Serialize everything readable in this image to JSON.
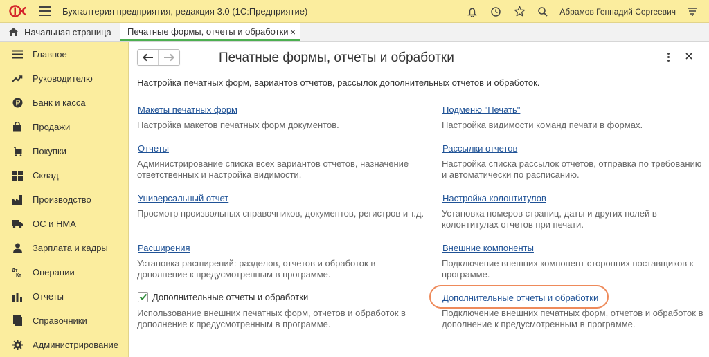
{
  "app": {
    "title": "Бухгалтерия предприятия, редакция 3.0  (1С:Предприятие)",
    "user": "Абрамов Геннадий Сергеевич"
  },
  "tabs": {
    "home": "Начальная страница",
    "active": "Печатные формы, отчеты и обработки",
    "close": "×"
  },
  "sidebar": {
    "items": [
      {
        "label": "Главное",
        "icon": "menu-lines-icon"
      },
      {
        "label": "Руководителю",
        "icon": "trend-icon"
      },
      {
        "label": "Банк и касса",
        "icon": "ruble-coin-icon"
      },
      {
        "label": "Продажи",
        "icon": "shopping-bag-icon"
      },
      {
        "label": "Покупки",
        "icon": "cart-icon"
      },
      {
        "label": "Склад",
        "icon": "warehouse-icon"
      },
      {
        "label": "Производство",
        "icon": "factory-icon"
      },
      {
        "label": "ОС и НМА",
        "icon": "truck-icon"
      },
      {
        "label": "Зарплата и кадры",
        "icon": "person-icon"
      },
      {
        "label": "Операции",
        "icon": "dt-kt-icon"
      },
      {
        "label": "Отчеты",
        "icon": "bar-chart-icon"
      },
      {
        "label": "Справочники",
        "icon": "book-icon"
      },
      {
        "label": "Администрирование",
        "icon": "gear-icon"
      }
    ]
  },
  "main": {
    "title": "Печатные формы, отчеты и обработки",
    "intro": "Настройка печатных форм, вариантов отчетов, рассылок дополнительных отчетов и обработок.",
    "left": [
      {
        "link": "Макеты печатных форм",
        "desc": "Настройка макетов печатных форм документов."
      },
      {
        "link": "Отчеты",
        "desc": "Администрирование списка всех вариантов отчетов, назначение ответственных и настройка видимости."
      },
      {
        "link": "Универсальный отчет",
        "desc": "Просмотр произвольных справочников, документов, регистров и т.д."
      },
      {
        "link": "Расширения",
        "desc": "Установка расширений: разделов, отчетов и обработок в дополнение к предусмотренным в программе."
      }
    ],
    "checkbox": {
      "label": "Дополнительные отчеты и обработки",
      "checked": true,
      "desc": "Использование внешних печатных форм, отчетов и обработок в дополнение к предусмотренным в программе."
    },
    "right": [
      {
        "link": "Подменю \"Печать\"",
        "desc": "Настройка видимости команд печати в формах."
      },
      {
        "link": "Рассылки отчетов",
        "desc": "Настройка списка рассылок отчетов, отправка по требованию и автоматически по расписанию."
      },
      {
        "link": "Настройка колонтитулов",
        "desc": "Установка номеров страниц, даты и других полей в колонтитулах отчетов при печати."
      },
      {
        "link": "Внешние компоненты",
        "desc": "Подключение внешних компонент сторонних поставщиков к программе."
      },
      {
        "link": "Дополнительные отчеты и обработки",
        "desc": "Подключение внешних печатных форм, отчетов и обработок в дополнение к предусмотренным в программе."
      }
    ]
  },
  "colors": {
    "accent_bar": "#fbed9e",
    "link": "#1f5296",
    "active_tab_underline": "#4caf50",
    "highlight": "#ee8a5a",
    "logo_red": "#d4232a"
  }
}
